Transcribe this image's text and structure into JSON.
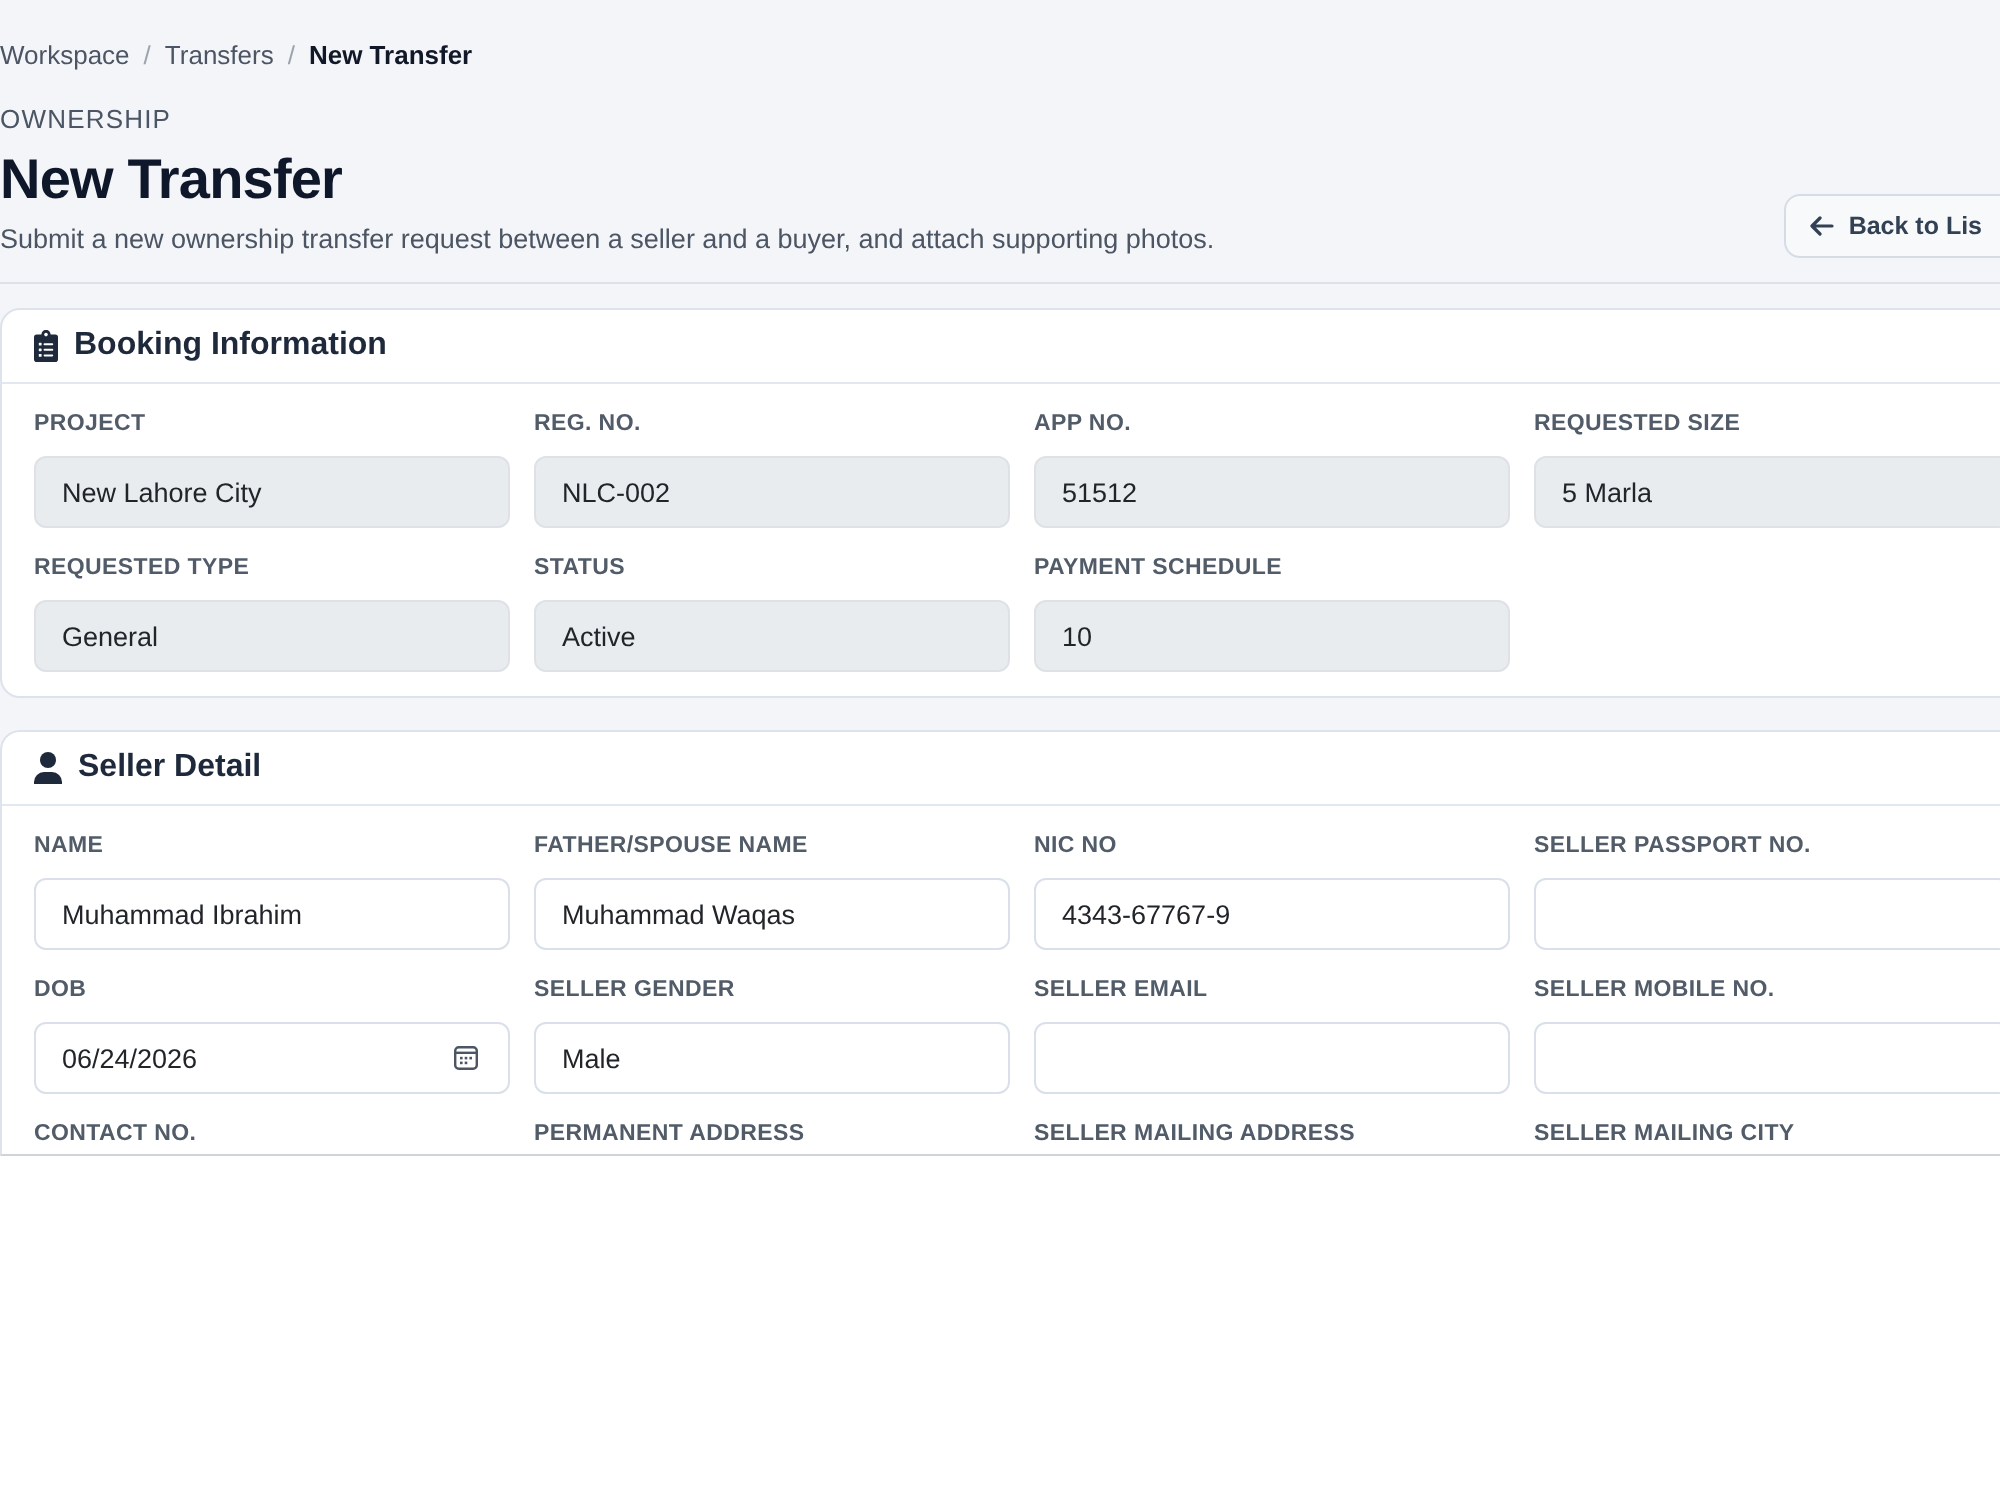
{
  "breadcrumb": {
    "items": [
      {
        "label": "Workspace",
        "current": false
      },
      {
        "label": "Transfers",
        "current": false
      },
      {
        "label": "New Transfer",
        "current": true
      }
    ],
    "separators": [
      "/",
      "/"
    ]
  },
  "header": {
    "eyebrow": "OWNERSHIP",
    "title": "New Transfer",
    "subtitle": "Submit a new ownership transfer request between a seller and a buyer, and attach supporting photos.",
    "back_button": "Back to Lis"
  },
  "sections": [
    {
      "title": "Booking Information",
      "fields": [
        {
          "label": "PROJECT",
          "kind": "readonly",
          "value": "New Lahore City"
        },
        {
          "label": "REG. NO.",
          "kind": "readonly",
          "value": "NLC-002"
        },
        {
          "label": "APP NO.",
          "kind": "readonly",
          "value": "51512"
        },
        {
          "label": "REQUESTED SIZE",
          "kind": "readonly",
          "value": "5 Marla"
        },
        {
          "label": "REQUESTED TYPE",
          "kind": "readonly",
          "value": "General"
        },
        {
          "label": "STATUS",
          "kind": "readonly",
          "value": "Active"
        },
        {
          "label": "PAYMENT SCHEDULE",
          "kind": "readonly",
          "value": "10"
        }
      ]
    },
    {
      "title": "Seller Detail",
      "fields": [
        {
          "label": "NAME",
          "kind": "text",
          "value": "Muhammad Ibrahim"
        },
        {
          "label": "FATHER/SPOUSE NAME",
          "kind": "text",
          "value": "Muhammad Waqas"
        },
        {
          "label": "NIC NO",
          "kind": "text",
          "value": "4343-67767-9"
        },
        {
          "label": "SELLER PASSPORT NO.",
          "kind": "text"
        },
        {
          "label": "DOB",
          "kind": "date",
          "value": "06/24/2026"
        },
        {
          "label": "SELLER GENDER",
          "kind": "text",
          "value": "Male"
        },
        {
          "label": "SELLER EMAIL",
          "kind": "text"
        },
        {
          "label": "SELLER MOBILE NO.",
          "kind": "text"
        },
        {
          "label": "CONTACT NO.",
          "kind": "label_only"
        },
        {
          "label": "PERMANENT ADDRESS",
          "kind": "label_only"
        },
        {
          "label": "SELLER MAILING ADDRESS",
          "kind": "label_only"
        },
        {
          "label": "SELLER MAILING CITY",
          "kind": "label_only"
        }
      ]
    }
  ]
}
